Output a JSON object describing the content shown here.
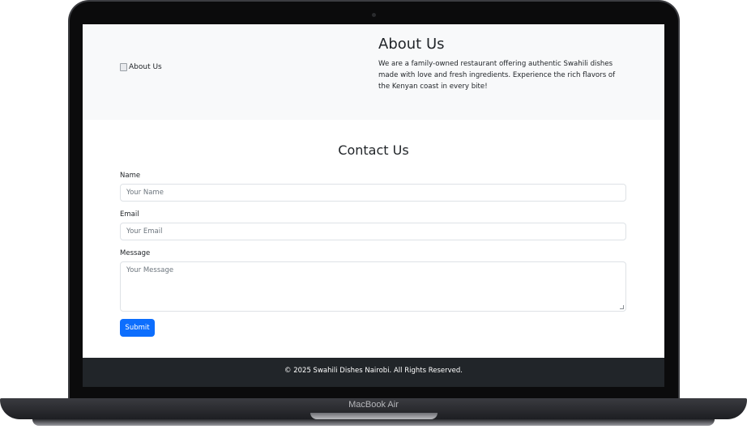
{
  "device": {
    "brand_label": "MacBook Air"
  },
  "about": {
    "image_alt": "About Us",
    "title": "About Us",
    "text": "We are a family-owned restaurant offering authentic Swahili dishes made with love and fresh ingredients. Experience the rich flavors of the Kenyan coast in every bite!"
  },
  "contact": {
    "title": "Contact Us",
    "name_label": "Name",
    "name_placeholder": "Your Name",
    "email_label": "Email",
    "email_placeholder": "Your Email",
    "message_label": "Message",
    "message_placeholder": "Your Message",
    "submit_label": "Submit"
  },
  "footer": {
    "copyright": "© 2025 Swahili Dishes Nairobi. All Rights Reserved."
  },
  "colors": {
    "primary": "#0d6efd",
    "footer_bg": "#212529",
    "section_bg": "#f8f9fa"
  }
}
